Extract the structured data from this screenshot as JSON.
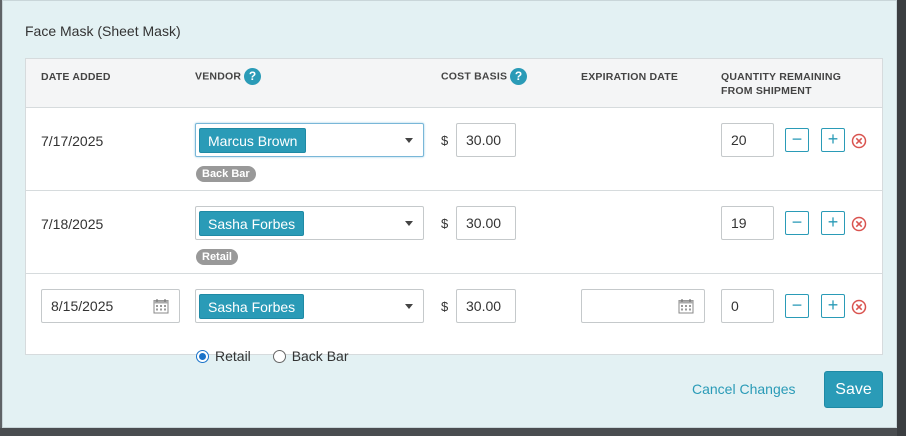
{
  "modal": {
    "title": "Face Mask (Sheet Mask)"
  },
  "table": {
    "headers": {
      "date_added": "DATE ADDED",
      "vendor": "VENDOR",
      "cost_basis": "COST BASIS",
      "expiration_date": "EXPIRATION DATE",
      "quantity_line1": "QUANTITY REMAINING",
      "quantity_line2": "FROM SHIPMENT"
    },
    "help_glyph": "?",
    "rows": [
      {
        "date": "7/17/2025",
        "vendor": "Marcus Brown",
        "tag": "Back Bar",
        "currency": "$",
        "cost": "30.00",
        "expiration": "",
        "quantity": "20"
      },
      {
        "date": "7/18/2025",
        "vendor": "Sasha Forbes",
        "tag": "Retail",
        "currency": "$",
        "cost": "30.00",
        "expiration": "",
        "quantity": "19"
      },
      {
        "date": "8/15/2025",
        "vendor": "Sasha Forbes",
        "currency": "$",
        "cost": "30.00",
        "expiration": "",
        "quantity": "0",
        "radio_options": [
          "Retail",
          "Back Bar"
        ],
        "radio_selected": "Retail"
      }
    ],
    "stepper": {
      "minus": "−",
      "plus": "+"
    }
  },
  "footer": {
    "cancel_label": "Cancel Changes",
    "save_label": "Save"
  },
  "colors": {
    "accent": "#2a9bb7",
    "remove": "#d9534f",
    "modal_bg": "#e3f1f3"
  },
  "icons": [
    "help-icon",
    "calendar-icon",
    "chevron-down-icon",
    "minus-icon",
    "plus-icon",
    "remove-circle-icon"
  ]
}
